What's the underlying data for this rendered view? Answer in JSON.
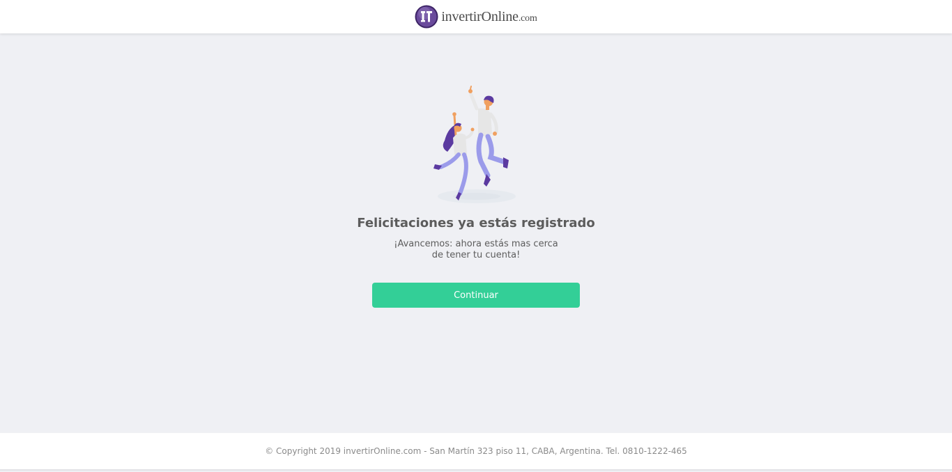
{
  "header": {
    "logo_text": "invertirOnline",
    "logo_suffix": ".com",
    "brand_color": "#5b3a8c"
  },
  "main": {
    "illustration": "two-people-jumping-celebration",
    "title": "Felicitaciones ya estás registrado",
    "subtitle": "¡Avancemos: ahora estás mas cerca de tener tu cuenta!",
    "continue_label": "Continuar",
    "button_color": "#33cf97"
  },
  "footer": {
    "copyright": "© Copyright 2019 invertirOnline.com - San Martín 323 piso 11, CABA, Argentina. Tel. 0810-1222-465"
  }
}
